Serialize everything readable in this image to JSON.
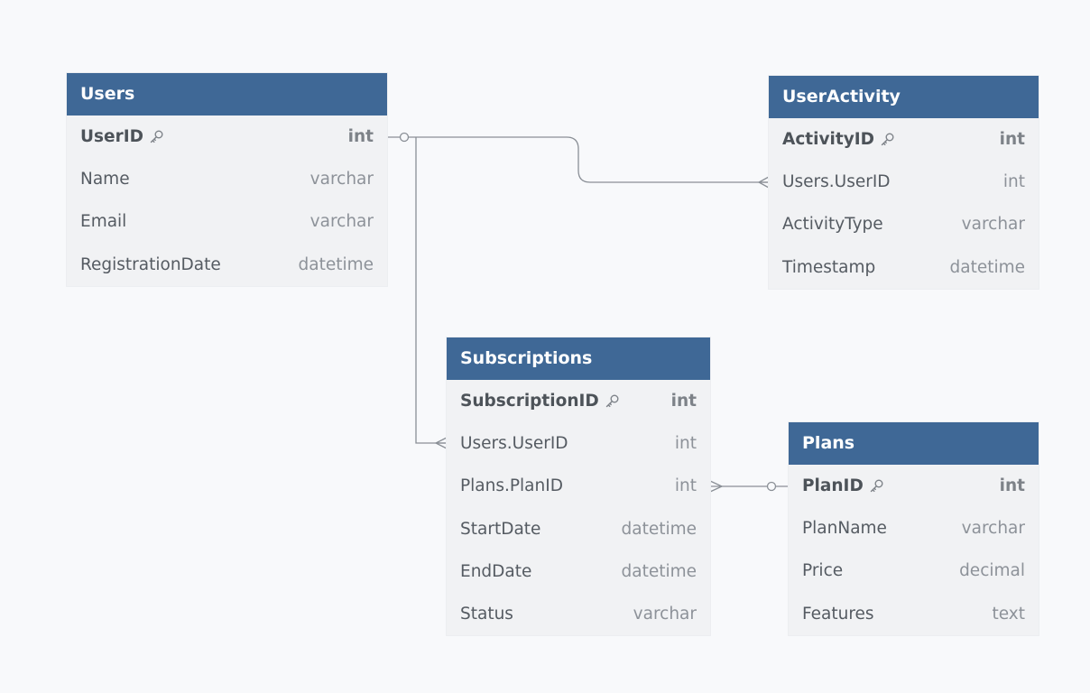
{
  "tables": [
    {
      "id": "users",
      "title": "Users",
      "fields": [
        {
          "name": "UserID",
          "type": "int",
          "pk": true,
          "icon": "key-icon"
        },
        {
          "name": "Name",
          "type": "varchar"
        },
        {
          "name": "Email",
          "type": "varchar"
        },
        {
          "name": "RegistrationDate",
          "type": "datetime"
        }
      ]
    },
    {
      "id": "useractivity",
      "title": "UserActivity",
      "fields": [
        {
          "name": "ActivityID",
          "type": "int",
          "pk": true,
          "icon": "key-icon"
        },
        {
          "name": "Users.UserID",
          "type": "int"
        },
        {
          "name": "ActivityType",
          "type": "varchar"
        },
        {
          "name": "Timestamp",
          "type": "datetime"
        }
      ]
    },
    {
      "id": "subscriptions",
      "title": "Subscriptions",
      "fields": [
        {
          "name": "SubscriptionID",
          "type": "int",
          "pk": true,
          "icon": "key-icon"
        },
        {
          "name": "Users.UserID",
          "type": "int"
        },
        {
          "name": "Plans.PlanID",
          "type": "int"
        },
        {
          "name": "StartDate",
          "type": "datetime"
        },
        {
          "name": "EndDate",
          "type": "datetime"
        },
        {
          "name": "Status",
          "type": "varchar"
        }
      ]
    },
    {
      "id": "plans",
      "title": "Plans",
      "fields": [
        {
          "name": "PlanID",
          "type": "int",
          "pk": true,
          "icon": "key-icon"
        },
        {
          "name": "PlanName",
          "type": "varchar"
        },
        {
          "name": "Price",
          "type": "decimal"
        },
        {
          "name": "Features",
          "type": "text"
        }
      ]
    }
  ],
  "relationships": [
    {
      "from": "Users.UserID",
      "to": "UserActivity.Users.UserID",
      "from_end": "one",
      "to_end": "many"
    },
    {
      "from": "Users.UserID",
      "to": "Subscriptions.Users.UserID",
      "from_end": "one",
      "to_end": "many"
    },
    {
      "from": "Subscriptions.Plans.PlanID",
      "to": "Plans.PlanID",
      "from_end": "many",
      "to_end": "one"
    }
  ],
  "colors": {
    "header": "#3f6896",
    "header_text": "#ffffff",
    "body": "#f1f2f4",
    "background": "#f8f9fb",
    "connector": "#8a8f96"
  }
}
